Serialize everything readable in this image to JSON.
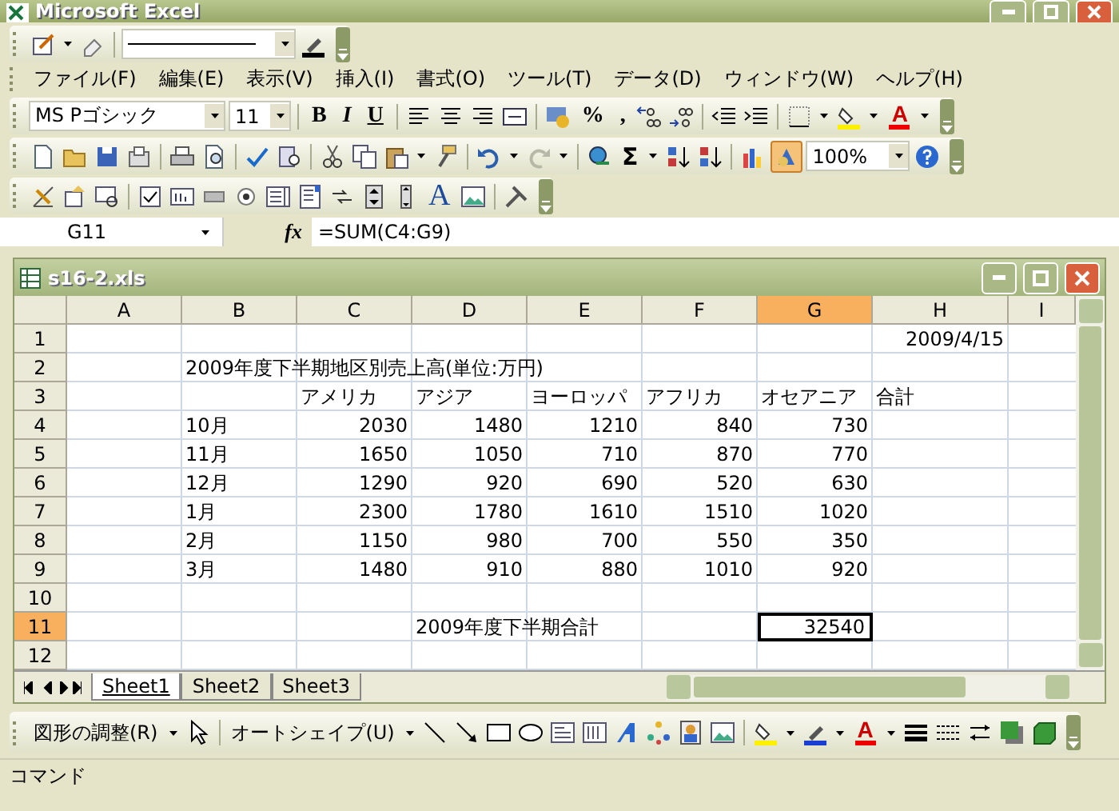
{
  "window": {
    "title": "Microsoft Excel"
  },
  "menu": [
    "ファイル(F)",
    "編集(E)",
    "表示(V)",
    "挿入(I)",
    "書式(O)",
    "ツール(T)",
    "データ(D)",
    "ウィンドウ(W)",
    "ヘルプ(H)"
  ],
  "formatting_toolbar": {
    "font": "MS Pゴシック",
    "size": "11",
    "bold": "B",
    "italic": "I",
    "underline": "U",
    "percent": "%",
    "comma": ",",
    "font_color": "A"
  },
  "standard_toolbar": {
    "autosum": "Σ",
    "zoom": "100%"
  },
  "forms_toolbar": {
    "label": "A"
  },
  "formula_bar": {
    "name_box": "G11",
    "fx": "fx",
    "formula": "=SUM(C4:G9)"
  },
  "workbook": {
    "title": "s16-2.xls",
    "columns": [
      {
        "label": "A",
        "selected": false
      },
      {
        "label": "B",
        "selected": false
      },
      {
        "label": "C",
        "selected": false
      },
      {
        "label": "D",
        "selected": false
      },
      {
        "label": "E",
        "selected": false
      },
      {
        "label": "F",
        "selected": false
      },
      {
        "label": "G",
        "selected": true
      },
      {
        "label": "H",
        "selected": false
      },
      {
        "label": "I",
        "selected": false
      }
    ],
    "rows": [
      {
        "label": "1",
        "selected": false,
        "cells": [
          null,
          null,
          null,
          null,
          null,
          null,
          null,
          {
            "text": "2009/4/15",
            "kind": "number"
          },
          null
        ]
      },
      {
        "label": "2",
        "selected": false,
        "cells": [
          null,
          {
            "text": "2009年度下半期地区別売上高(単位:万円)",
            "kind": "text"
          },
          null,
          null,
          null,
          null,
          null,
          null,
          null
        ]
      },
      {
        "label": "3",
        "selected": false,
        "cells": [
          null,
          null,
          {
            "text": "アメリカ",
            "kind": "text"
          },
          {
            "text": "アジア",
            "kind": "text"
          },
          {
            "text": "ヨーロッパ",
            "kind": "text"
          },
          {
            "text": "アフリカ",
            "kind": "text"
          },
          {
            "text": "オセアニア",
            "kind": "text"
          },
          {
            "text": "合計",
            "kind": "text"
          },
          null
        ]
      },
      {
        "label": "4",
        "selected": false,
        "cells": [
          null,
          {
            "text": "10月",
            "kind": "text"
          },
          {
            "text": "2030",
            "kind": "number"
          },
          {
            "text": "1480",
            "kind": "number"
          },
          {
            "text": "1210",
            "kind": "number"
          },
          {
            "text": "840",
            "kind": "number"
          },
          {
            "text": "730",
            "kind": "number"
          },
          null,
          null
        ]
      },
      {
        "label": "5",
        "selected": false,
        "cells": [
          null,
          {
            "text": "11月",
            "kind": "text"
          },
          {
            "text": "1650",
            "kind": "number"
          },
          {
            "text": "1050",
            "kind": "number"
          },
          {
            "text": "710",
            "kind": "number"
          },
          {
            "text": "870",
            "kind": "number"
          },
          {
            "text": "770",
            "kind": "number"
          },
          null,
          null
        ]
      },
      {
        "label": "6",
        "selected": false,
        "cells": [
          null,
          {
            "text": "12月",
            "kind": "text"
          },
          {
            "text": "1290",
            "kind": "number"
          },
          {
            "text": "920",
            "kind": "number"
          },
          {
            "text": "690",
            "kind": "number"
          },
          {
            "text": "520",
            "kind": "number"
          },
          {
            "text": "630",
            "kind": "number"
          },
          null,
          null
        ]
      },
      {
        "label": "7",
        "selected": false,
        "cells": [
          null,
          {
            "text": "1月",
            "kind": "text"
          },
          {
            "text": "2300",
            "kind": "number"
          },
          {
            "text": "1780",
            "kind": "number"
          },
          {
            "text": "1610",
            "kind": "number"
          },
          {
            "text": "1510",
            "kind": "number"
          },
          {
            "text": "1020",
            "kind": "number"
          },
          null,
          null
        ]
      },
      {
        "label": "8",
        "selected": false,
        "cells": [
          null,
          {
            "text": "2月",
            "kind": "text"
          },
          {
            "text": "1150",
            "kind": "number"
          },
          {
            "text": "980",
            "kind": "number"
          },
          {
            "text": "700",
            "kind": "number"
          },
          {
            "text": "550",
            "kind": "number"
          },
          {
            "text": "350",
            "kind": "number"
          },
          null,
          null
        ]
      },
      {
        "label": "9",
        "selected": false,
        "cells": [
          null,
          {
            "text": "3月",
            "kind": "text"
          },
          {
            "text": "1480",
            "kind": "number"
          },
          {
            "text": "910",
            "kind": "number"
          },
          {
            "text": "880",
            "kind": "number"
          },
          {
            "text": "1010",
            "kind": "number"
          },
          {
            "text": "920",
            "kind": "number"
          },
          null,
          null
        ]
      },
      {
        "label": "10",
        "selected": false,
        "cells": [
          null,
          null,
          null,
          null,
          null,
          null,
          null,
          null,
          null
        ]
      },
      {
        "label": "11",
        "selected": true,
        "cells": [
          null,
          null,
          null,
          {
            "text": "2009年度下半期合計",
            "kind": "text"
          },
          null,
          null,
          {
            "text": "32540",
            "kind": "number"
          },
          null,
          null
        ]
      },
      {
        "label": "12",
        "selected": false,
        "cells": [
          null,
          null,
          null,
          null,
          null,
          null,
          null,
          null,
          null
        ]
      }
    ],
    "sheets": [
      {
        "label": "Sheet1",
        "selected": true
      },
      {
        "label": "Sheet2",
        "selected": false
      },
      {
        "label": "Sheet3",
        "selected": false
      }
    ]
  },
  "drawing_toolbar": {
    "draw_menu": "図形の調整(R)",
    "autoshapes_menu": "オートシェイプ(U)",
    "font_color": "A"
  },
  "status_bar": {
    "text": "コマンド"
  }
}
